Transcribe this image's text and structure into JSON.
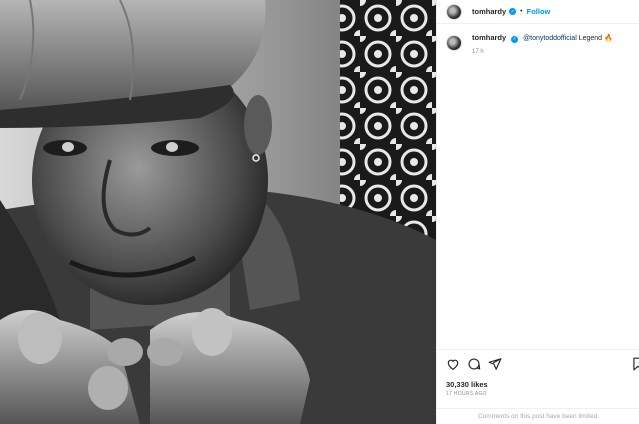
{
  "post": {
    "username": "tomhardy",
    "verified_icon": "verified-badge-icon",
    "separator": "•",
    "follow_label": "Follow"
  },
  "caption": {
    "username": "tomhardy",
    "mention": "@tonytoddofficial",
    "text": "Legend",
    "emoji": "🔥",
    "age": "17 h"
  },
  "stats": {
    "likes": "30,330 likes",
    "time_ago": "17 HOURS AGO"
  },
  "comments_notice": "Comments on this post have been limited.",
  "icons": [
    "heart-icon",
    "comment-icon",
    "share-icon",
    "bookmark-icon"
  ],
  "colors": {
    "accent": "#0095f6",
    "text": "#262626",
    "muted": "#8e8e8e",
    "mention": "#00376b"
  }
}
